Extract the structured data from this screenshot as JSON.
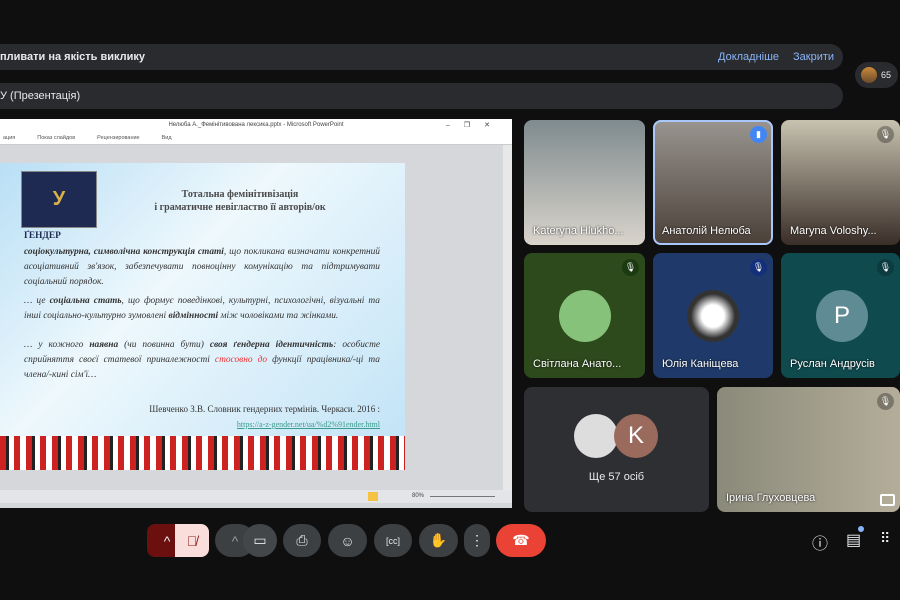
{
  "banner_warning": {
    "text": "пливати на якість виклику",
    "learn_more": "Докладніше",
    "close": "Закрити"
  },
  "participants_badge": {
    "count": "65"
  },
  "banner_presentation": {
    "text": "У (Презентація)"
  },
  "powerpoint": {
    "title": "Нелюба А._Фемінітивована лексика.pptx - Microsoft PowerPoint",
    "tabs": [
      "ация",
      "Показ слайдов",
      "Рецензирование",
      "Вид"
    ],
    "zoom": "80%",
    "slide": {
      "logo_text": "У",
      "title_line1": "Тотальна фемінітивізація",
      "title_line2": "і граматичне невігластво її авторів/ок",
      "heading": "ҐЕНДЕР",
      "p1_bold": "соціокультурна, символічна конструкція статі",
      "p1_rest": ", що покликана визначати конкретний асоціативний зв'язок, забезпечувати повноцінну комунікацію та підтримувати соціальний порядок.",
      "p2_a": "… це ",
      "p2_bold": "соціальна стать",
      "p2_b": ", що формує поведінкові, культурні, психологічні, візуальні та інші соціально-культурно зумовлені ",
      "p2_bold2": "відмінності",
      "p2_c": " між чоловіками та жінками.",
      "p3_a": "… у кожного ",
      "p3_bold": "наявна",
      "p3_b": " (чи повинна бути) ",
      "p3_bold2": "своя ґендерна ідентичність",
      "p3_c": ": особисте сприйняття своєї статевої приналежності ",
      "p3_red": "стосовно до",
      "p3_d": " функції працівника/-ці та члена/-кині сім'ї…",
      "source": "Шевченко З.В. Словник гендерних термінів. Черкаси. 2016 :",
      "url": "https://a-z-gender.net/ua/%d2%91ender.html"
    }
  },
  "tiles": [
    {
      "name": "Kateryna Hlukho..."
    },
    {
      "name": "Анатолій Нелюба"
    },
    {
      "name": "Maryna Voloshy..."
    },
    {
      "name": "Світлана Анато..."
    },
    {
      "name": "Юлія Каніщева"
    },
    {
      "name": "Руслан Андрусів",
      "initial": "Р"
    },
    {
      "name": "Ще 57 осіб",
      "initial": "K"
    },
    {
      "name": "Ірина Глуховцева"
    }
  ],
  "colors": {
    "end_call": "#ea4335",
    "mic_off_bg": "#f9dedc",
    "mic_group": "#6b0f0f",
    "accent": "#8ab4f8"
  }
}
